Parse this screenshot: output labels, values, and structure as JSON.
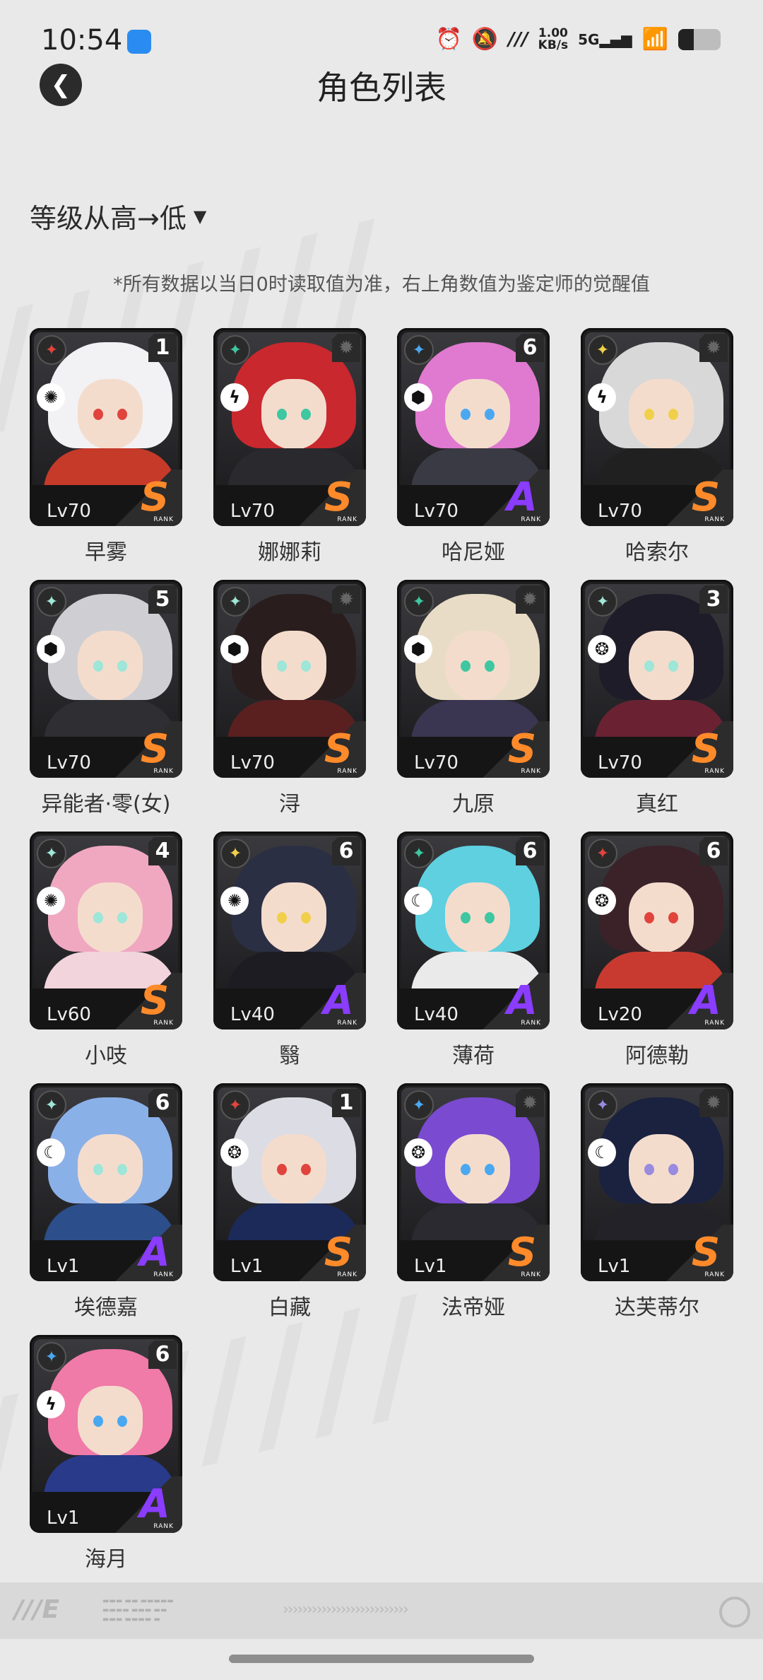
{
  "status_bar": {
    "time": "10:54",
    "net_speed_value": "1.00",
    "net_speed_unit": "KB/s",
    "network": "5G"
  },
  "header": {
    "title": "角色列表"
  },
  "sort": {
    "label": "等级从高→低"
  },
  "note": "*所有数据以当日0时读取值为准，右上角数值为鉴定师的觉醒值",
  "rank_sub": "RANK",
  "characters": [
    {
      "name": "早雾",
      "level": "Lv70",
      "rank": "S",
      "awake": "1",
      "attr_color": "#e0443c",
      "role": "spiral",
      "hair": "#f2f2f4",
      "body": "#c63a2a"
    },
    {
      "name": "娜娜莉",
      "level": "Lv70",
      "rank": "S",
      "awake": "",
      "attr_color": "#3ec7a0",
      "role": "bolt",
      "hair": "#c8282e",
      "body": "#2a2a2e"
    },
    {
      "name": "哈尼娅",
      "level": "Lv70",
      "rank": "A",
      "awake": "6",
      "attr_color": "#4aa8f0",
      "role": "cube",
      "hair": "#e07ad0",
      "body": "#3a3a44"
    },
    {
      "name": "哈索尔",
      "level": "Lv70",
      "rank": "S",
      "awake": "",
      "attr_color": "#f0d04a",
      "role": "bolt",
      "hair": "#d8d8d8",
      "body": "#202020"
    },
    {
      "name": "异能者·零(女)",
      "level": "Lv70",
      "rank": "S",
      "awake": "5",
      "attr_color": "#9ee6d8",
      "role": "cube",
      "hair": "#cfcfd3",
      "body": "#2e2e33"
    },
    {
      "name": "浔",
      "level": "Lv70",
      "rank": "S",
      "awake": "",
      "attr_color": "#9ee6d8",
      "role": "cube",
      "hair": "#2a1d1d",
      "body": "#5a2020"
    },
    {
      "name": "九原",
      "level": "Lv70",
      "rank": "S",
      "awake": "",
      "attr_color": "#3ec7a0",
      "role": "cube",
      "hair": "#e8dcc6",
      "body": "#3a3550"
    },
    {
      "name": "真红",
      "level": "Lv70",
      "rank": "S",
      "awake": "3",
      "attr_color": "#9ee6d8",
      "role": "gear",
      "hair": "#1e1c28",
      "body": "#6a2233"
    },
    {
      "name": "小吱",
      "level": "Lv60",
      "rank": "S",
      "awake": "4",
      "attr_color": "#9ee6d8",
      "role": "spiral",
      "hair": "#f0a8c0",
      "body": "#f2d4dc"
    },
    {
      "name": "翳",
      "level": "Lv40",
      "rank": "A",
      "awake": "6",
      "attr_color": "#f0d04a",
      "role": "spiral",
      "hair": "#2b2f44",
      "body": "#1c1c22"
    },
    {
      "name": "薄荷",
      "level": "Lv40",
      "rank": "A",
      "awake": "6",
      "attr_color": "#3ec7a0",
      "role": "moon",
      "hair": "#5ed0e0",
      "body": "#eaeaea"
    },
    {
      "name": "阿德勒",
      "level": "Lv20",
      "rank": "A",
      "awake": "6",
      "attr_color": "#e0443c",
      "role": "gear",
      "hair": "#3a2228",
      "body": "#c83a30"
    },
    {
      "name": "埃德嘉",
      "level": "Lv1",
      "rank": "A",
      "awake": "6",
      "attr_color": "#9ee6d8",
      "role": "moon",
      "hair": "#8ab0e8",
      "body": "#2c4e8a"
    },
    {
      "name": "白藏",
      "level": "Lv1",
      "rank": "S",
      "awake": "1",
      "attr_color": "#e0443c",
      "role": "gear",
      "hair": "#dcdce4",
      "body": "#1c2a5a"
    },
    {
      "name": "法帝娅",
      "level": "Lv1",
      "rank": "S",
      "awake": "",
      "attr_color": "#4aa8f0",
      "role": "gear",
      "hair": "#7a4ad0",
      "body": "#2a2a30"
    },
    {
      "name": "达芙蒂尔",
      "level": "Lv1",
      "rank": "S",
      "awake": "",
      "attr_color": "#9a8ae0",
      "role": "moon",
      "hair": "#1a2240",
      "body": "#222228"
    },
    {
      "name": "海月",
      "level": "Lv1",
      "rank": "A",
      "awake": "6",
      "attr_color": "#4aa8f0",
      "role": "bolt",
      "hair": "#f07aa8",
      "body": "#2a3a8a"
    }
  ]
}
